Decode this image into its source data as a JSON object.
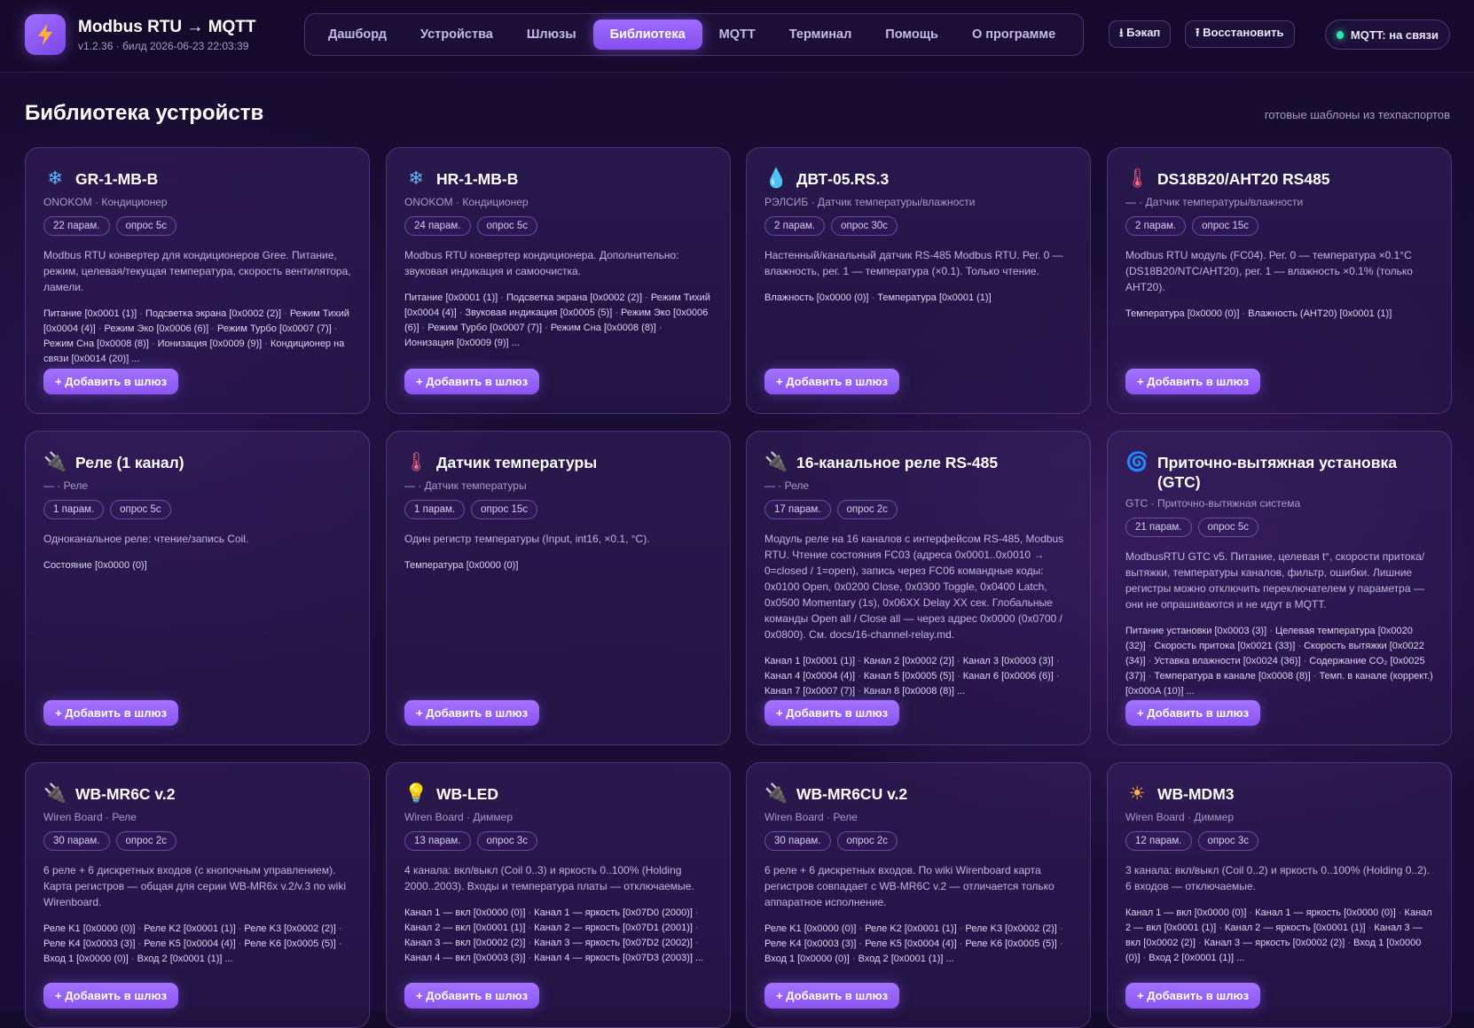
{
  "header": {
    "app_title": "Modbus RTU → MQTT",
    "version": "v1.2.36 · билд 2026-06-23 22:03:39",
    "nav": [
      {
        "label": "Дашборд",
        "active": false
      },
      {
        "label": "Устройства",
        "active": false
      },
      {
        "label": "Шлюзы",
        "active": false
      },
      {
        "label": "Библиотека",
        "active": true
      },
      {
        "label": "MQTT",
        "active": false
      },
      {
        "label": "Терминал",
        "active": false
      },
      {
        "label": "Помощь",
        "active": false
      },
      {
        "label": "О программе",
        "active": false
      }
    ],
    "backup_label": "⭳ Бэкап",
    "restore_label": "⭱ Восстановить",
    "mqtt_status": "MQTT: на связи"
  },
  "page": {
    "title": "Библиотека устройств",
    "subtitle": "готовые шаблоны из техпаспортов"
  },
  "add_label": "+ Добавить в шлюз",
  "cards": [
    {
      "icon": "snowflake-icon",
      "glyph": "❄",
      "glyph_color": "#5fb8ff",
      "title": "GR-1-MB-B",
      "meta": "ONOKOM · Кондиционер",
      "params": "22 парам.",
      "poll": "опрос 5с",
      "desc": "Modbus RTU конвертер для кондиционеров Gree. Питание, режим, целевая/текущая температура, скорость вентилятора, ламели.",
      "registers": [
        {
          "name": "Питание",
          "addr": "[0x0001 (1)]"
        },
        {
          "name": "Подсветка экрана",
          "addr": "[0x0002 (2)]"
        },
        {
          "name": "Режим Тихий",
          "addr": "[0x0004 (4)]"
        },
        {
          "name": "Режим Эко",
          "addr": "[0x0006 (6)]"
        },
        {
          "name": "Режим Турбо",
          "addr": "[0x0007 (7)]"
        },
        {
          "name": "Режим Сна",
          "addr": "[0x0008 (8)]"
        },
        {
          "name": "Ионизация",
          "addr": "[0x0009 (9)]"
        },
        {
          "name": "Кондиционер на связи",
          "addr": "[0x0014 (20)]"
        }
      ],
      "more": "..."
    },
    {
      "icon": "snowflake-icon",
      "glyph": "❄",
      "glyph_color": "#5fb8ff",
      "title": "HR-1-MB-B",
      "meta": "ONOKOM · Кондиционер",
      "params": "24 парам.",
      "poll": "опрос 5с",
      "desc": "Modbus RTU конвертер кондиционера. Дополнительно: звуковая индикация и самоочистка.",
      "registers": [
        {
          "name": "Питание",
          "addr": "[0x0001 (1)]"
        },
        {
          "name": "Подсветка экрана",
          "addr": "[0x0002 (2)]"
        },
        {
          "name": "Режим Тихий",
          "addr": "[0x0004 (4)]"
        },
        {
          "name": "Звуковая индикация",
          "addr": "[0x0005 (5)]"
        },
        {
          "name": "Режим Эко",
          "addr": "[0x0006 (6)]"
        },
        {
          "name": "Режим Турбо",
          "addr": "[0x0007 (7)]"
        },
        {
          "name": "Режим Сна",
          "addr": "[0x0008 (8)]"
        },
        {
          "name": "Ионизация",
          "addr": "[0x0009 (9)]"
        }
      ],
      "more": "..."
    },
    {
      "icon": "water-drop-icon",
      "glyph": "💧",
      "glyph_color": "#4fb2ff",
      "title": "ДВТ-05.RS.3",
      "meta": "РЭЛСИБ · Датчик температуры/влажности",
      "params": "2 парам.",
      "poll": "опрос 30с",
      "desc": "Настенный/канальный датчик RS-485 Modbus RTU. Рег. 0 — влажность, рег. 1 — температура (×0.1). Только чтение.",
      "registers": [
        {
          "name": "Влажность",
          "addr": "[0x0000 (0)]"
        },
        {
          "name": "Температура",
          "addr": "[0x0001 (1)]"
        }
      ],
      "more": ""
    },
    {
      "icon": "thermometer-icon",
      "glyph": "🌡",
      "glyph_color": "#ff6a8a",
      "title": "DS18B20/AHT20 RS485",
      "meta": "— · Датчик температуры/влажности",
      "params": "2 парам.",
      "poll": "опрос 15с",
      "desc": "Modbus RTU модуль (FC04). Рег. 0 — температура ×0.1°C (DS18B20/NTC/AHT20), рег. 1 — влажность ×0.1% (только AHT20).",
      "registers": [
        {
          "name": "Температура",
          "addr": "[0x0000 (0)]"
        },
        {
          "name": "Влажность (AHT20)",
          "addr": "[0x0001 (1)]"
        }
      ],
      "more": ""
    },
    {
      "icon": "relay-plug-icon",
      "glyph": "🔌",
      "glyph_color": "#b9a7d9",
      "title": "Реле (1 канал)",
      "meta": "— · Реле",
      "params": "1 парам.",
      "poll": "опрос 5с",
      "desc": "Одноканальное реле: чтение/запись Coil.",
      "registers": [
        {
          "name": "Состояние",
          "addr": "[0x0000 (0)]"
        }
      ],
      "more": ""
    },
    {
      "icon": "thermometer-icon",
      "glyph": "🌡",
      "glyph_color": "#ff6a8a",
      "title": "Датчик температуры",
      "meta": "— · Датчик температуры",
      "params": "1 парам.",
      "poll": "опрос 15с",
      "desc": "Один регистр температуры (Input, int16, ×0.1, °C).",
      "registers": [
        {
          "name": "Температура",
          "addr": "[0x0000 (0)]"
        }
      ],
      "more": ""
    },
    {
      "icon": "relay-plug-icon",
      "glyph": "🔌",
      "glyph_color": "#b9a7d9",
      "title": "16-канальное реле RS-485",
      "meta": "— · Реле",
      "params": "17 парам.",
      "poll": "опрос 2с",
      "desc": "Модуль реле на 16 каналов с интерфейсом RS-485, Modbus RTU. Чтение состояния FC03 (адреса 0x0001..0x0010 → 0=closed / 1=open), запись через FC06 командные коды: 0x0100 Open, 0x0200 Close, 0x0300 Toggle, 0x0400 Latch, 0x0500 Momentary (1s), 0x06XX Delay XX сек. Глобальные команды Open all / Close all — через адрес 0x0000 (0x0700 / 0x0800). См. docs/16-channel-relay.md.",
      "registers": [
        {
          "name": "Канал 1",
          "addr": "[0x0001 (1)]"
        },
        {
          "name": "Канал 2",
          "addr": "[0x0002 (2)]"
        },
        {
          "name": "Канал 3",
          "addr": "[0x0003 (3)]"
        },
        {
          "name": "Канал 4",
          "addr": "[0x0004 (4)]"
        },
        {
          "name": "Канал 5",
          "addr": "[0x0005 (5)]"
        },
        {
          "name": "Канал 6",
          "addr": "[0x0006 (6)]"
        },
        {
          "name": "Канал 7",
          "addr": "[0x0007 (7)]"
        },
        {
          "name": "Канал 8",
          "addr": "[0x0008 (8)]"
        }
      ],
      "more": "..."
    },
    {
      "icon": "ventilation-swirl-icon",
      "glyph": "🌀",
      "glyph_color": "#6c8cff",
      "title": "Приточно-вытяжная установка (GTC)",
      "meta": "GTC · Приточно-вытяжная система",
      "params": "21 парам.",
      "poll": "опрос 5с",
      "desc": "ModbusRTU GTC v5. Питание, целевая t°, скорости притока/вытяжки, температуры каналов, фильтр, ошибки. Лишние регистры можно отключить переключателем у параметра — они не опрашиваются и не идут в MQTT.",
      "registers": [
        {
          "name": "Питание установки",
          "addr": "[0x0003 (3)]"
        },
        {
          "name": "Целевая температура",
          "addr": "[0x0020 (32)]"
        },
        {
          "name": "Скорость притока",
          "addr": "[0x0021 (33)]"
        },
        {
          "name": "Скорость вытяжки",
          "addr": "[0x0022 (34)]"
        },
        {
          "name": "Уставка влажности",
          "addr": "[0x0024 (36)]"
        },
        {
          "name": "Содержание CO₂",
          "addr": "[0x0025 (37)]"
        },
        {
          "name": "Температура в канале",
          "addr": "[0x0008 (8)]"
        },
        {
          "name": "Темп. в канале (коррект.)",
          "addr": "[0x000A (10)]"
        }
      ],
      "more": "..."
    },
    {
      "icon": "relay-plug-icon",
      "glyph": "🔌",
      "glyph_color": "#b9a7d9",
      "title": "WB-MR6C v.2",
      "meta": "Wiren Board · Реле",
      "params": "30 парам.",
      "poll": "опрос 2с",
      "desc": "6 реле + 6 дискретных входов (с кнопочным управлением). Карта регистров — общая для серии WB-MR6x v.2/v.3 по wiki Wirenboard.",
      "registers": [
        {
          "name": "Реле K1",
          "addr": "[0x0000 (0)]"
        },
        {
          "name": "Реле K2",
          "addr": "[0x0001 (1)]"
        },
        {
          "name": "Реле K3",
          "addr": "[0x0002 (2)]"
        },
        {
          "name": "Реле K4",
          "addr": "[0x0003 (3)]"
        },
        {
          "name": "Реле K5",
          "addr": "[0x0004 (4)]"
        },
        {
          "name": "Реле K6",
          "addr": "[0x0005 (5)]"
        },
        {
          "name": "Вход 1",
          "addr": "[0x0000 (0)]"
        },
        {
          "name": "Вход 2",
          "addr": "[0x0001 (1)]"
        }
      ],
      "more": "..."
    },
    {
      "icon": "light-bulb-icon",
      "glyph": "💡",
      "glyph_color": "#ffd54a",
      "title": "WB-LED",
      "meta": "Wiren Board · Диммер",
      "params": "13 парам.",
      "poll": "опрос 3с",
      "desc": "4 канала: вкл/выкл (Coil 0..3) и яркость 0..100% (Holding 2000..2003). Входы и температура платы — отключаемые.",
      "registers": [
        {
          "name": "Канал 1 — вкл",
          "addr": "[0x0000 (0)]"
        },
        {
          "name": "Канал 1 — яркость",
          "addr": "[0x07D0 (2000)]"
        },
        {
          "name": "Канал 2 — вкл",
          "addr": "[0x0001 (1)]"
        },
        {
          "name": "Канал 2 — яркость",
          "addr": "[0x07D1 (2001)]"
        },
        {
          "name": "Канал 3 — вкл",
          "addr": "[0x0002 (2)]"
        },
        {
          "name": "Канал 3 — яркость",
          "addr": "[0x07D2 (2002)]"
        },
        {
          "name": "Канал 4 — вкл",
          "addr": "[0x0003 (3)]"
        },
        {
          "name": "Канал 4 — яркость",
          "addr": "[0x07D3 (2003)]"
        }
      ],
      "more": "..."
    },
    {
      "icon": "relay-plug-icon",
      "glyph": "🔌",
      "glyph_color": "#b9a7d9",
      "title": "WB-MR6CU v.2",
      "meta": "Wiren Board · Реле",
      "params": "30 парам.",
      "poll": "опрос 2с",
      "desc": "6 реле + 6 дискретных входов. По wiki Wirenboard карта регистров совпадает с WB-MR6C v.2 — отличается только аппаратное исполнение.",
      "registers": [
        {
          "name": "Реле K1",
          "addr": "[0x0000 (0)]"
        },
        {
          "name": "Реле K2",
          "addr": "[0x0001 (1)]"
        },
        {
          "name": "Реле K3",
          "addr": "[0x0002 (2)]"
        },
        {
          "name": "Реле K4",
          "addr": "[0x0003 (3)]"
        },
        {
          "name": "Реле K5",
          "addr": "[0x0004 (4)]"
        },
        {
          "name": "Реле K6",
          "addr": "[0x0005 (5)]"
        },
        {
          "name": "Вход 1",
          "addr": "[0x0000 (0)]"
        },
        {
          "name": "Вход 2",
          "addr": "[0x0001 (1)]"
        }
      ],
      "more": "..."
    },
    {
      "icon": "sun-dimmer-icon",
      "glyph": "☀",
      "glyph_color": "#ffb347",
      "title": "WB-MDM3",
      "meta": "Wiren Board · Диммер",
      "params": "12 парам.",
      "poll": "опрос 3с",
      "desc": "3 канала: вкл/выкл (Coil 0..2) и яркость 0..100% (Holding 0..2). 6 входов — отключаемые.",
      "registers": [
        {
          "name": "Канал 1 — вкл",
          "addr": "[0x0000 (0)]"
        },
        {
          "name": "Канал 1 — яркость",
          "addr": "[0x0000 (0)]"
        },
        {
          "name": "Канал 2 — вкл",
          "addr": "[0x0001 (1)]"
        },
        {
          "name": "Канал 2 — яркость",
          "addr": "[0x0001 (1)]"
        },
        {
          "name": "Канал 3 — вкл",
          "addr": "[0x0002 (2)]"
        },
        {
          "name": "Канал 3 — яркость",
          "addr": "[0x0002 (2)]"
        },
        {
          "name": "Вход 1",
          "addr": "[0x0000 (0)]"
        },
        {
          "name": "Вход 2",
          "addr": "[0x0001 (1)]"
        }
      ],
      "more": "..."
    }
  ]
}
